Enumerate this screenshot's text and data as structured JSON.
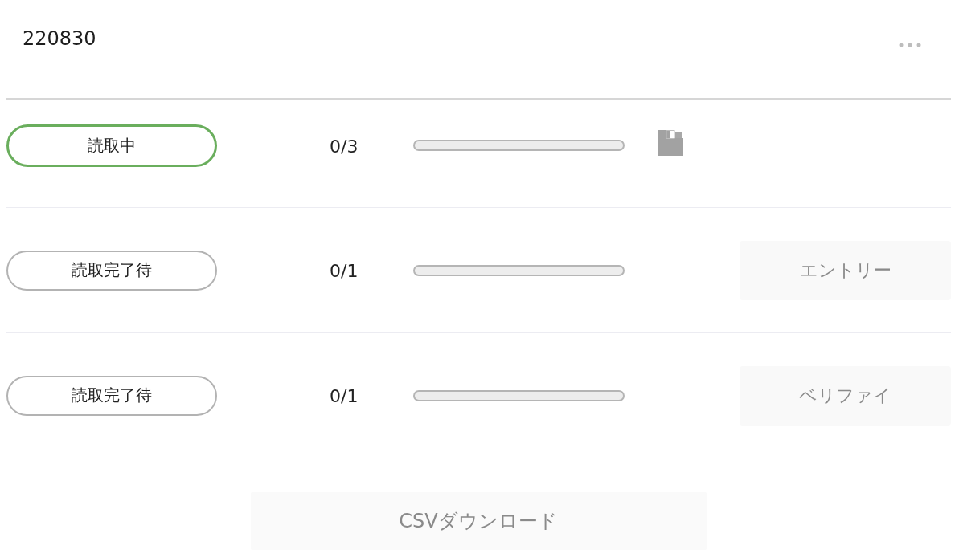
{
  "header": {
    "title": "220830"
  },
  "rows": [
    {
      "kind": "icon",
      "status": {
        "label": "読取中",
        "active": true
      },
      "count": "0/3",
      "progress": {
        "level": 0
      }
    },
    {
      "kind": "button",
      "status": {
        "label": "読取完了待",
        "active": false
      },
      "count": "0/1",
      "progress": {
        "level": 0
      },
      "button": "エントリー"
    },
    {
      "kind": "button",
      "status": {
        "label": "読取完了待",
        "active": false
      },
      "count": "0/1",
      "progress": {
        "level": 0
      },
      "button": "ベリファイ"
    }
  ],
  "csv_button": "CSVダウンロード"
}
